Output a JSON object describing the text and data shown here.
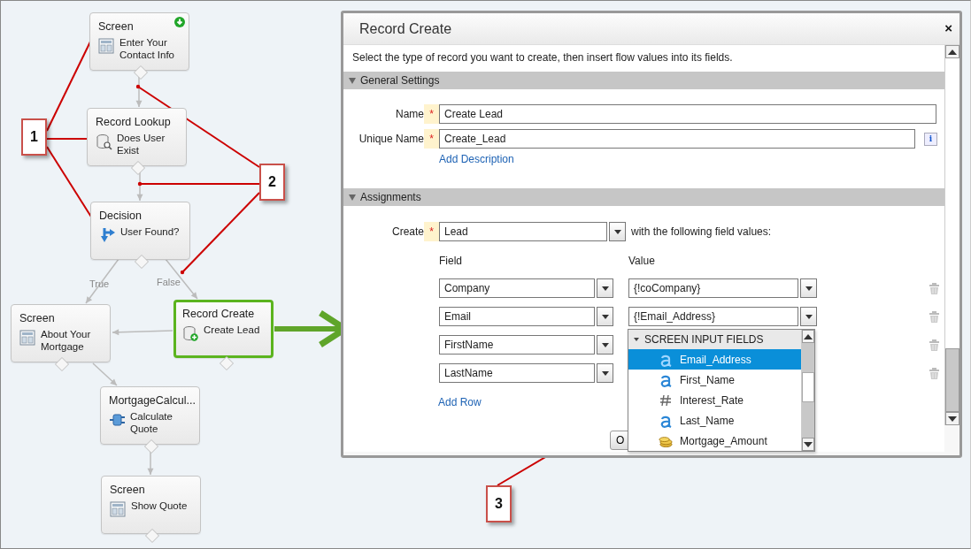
{
  "flow_nodes": [
    {
      "kind": "screen",
      "type": "Screen",
      "label": "Enter Your Contact Info",
      "start": true,
      "selected": false
    },
    {
      "kind": "lookup",
      "type": "Record Lookup",
      "label": "Does User Exist",
      "start": false,
      "selected": false
    },
    {
      "kind": "decision",
      "type": "Decision",
      "label": "User Found?",
      "start": false,
      "selected": false
    },
    {
      "kind": "screen",
      "type": "Screen",
      "label": "About Your Mortgage",
      "start": false,
      "selected": false
    },
    {
      "kind": "create",
      "type": "Record Create",
      "label": "Create Lead",
      "start": false,
      "selected": true
    },
    {
      "kind": "apex",
      "type": "MortgageCalcul...",
      "label": "Calculate Quote",
      "start": false,
      "selected": false
    },
    {
      "kind": "screen",
      "type": "Screen",
      "label": "Show Quote",
      "start": false,
      "selected": false
    }
  ],
  "branch_labels": [
    "True",
    "False"
  ],
  "callouts": [
    "1",
    "2",
    "3"
  ],
  "dialog": {
    "title": "Record Create",
    "close": "×",
    "intro": "Select the type of record you want to create, then insert flow values into its fields.",
    "general_settings": {
      "heading": "General Settings",
      "name_label": "Name",
      "name_mark": "*",
      "name_value": "Create Lead",
      "unique_label": "Unique Name",
      "unique_mark": "*",
      "unique_value": "Create_Lead",
      "info": "i",
      "add_description": "Add Description"
    },
    "assignments": {
      "heading": "Assignments",
      "create_label": "Create",
      "create_mark": "*",
      "create_value": "Lead",
      "create_suffix": "with the following field values:",
      "field_heading": "Field",
      "value_heading": "Value",
      "rows": [
        {
          "field": "Company",
          "value": "{!coCompany}"
        },
        {
          "field": "Email",
          "value": "{!Email_Address}"
        },
        {
          "field": "FirstName"
        },
        {
          "field": "LastName"
        }
      ],
      "add_row": "Add Row"
    },
    "ok_button": "O",
    "dropdown": {
      "group": "SCREEN INPUT FIELDS",
      "items": [
        {
          "kind": "text",
          "label": "Email_Address",
          "selected": true
        },
        {
          "kind": "text",
          "label": "First_Name",
          "selected": false
        },
        {
          "kind": "number",
          "label": "Interest_Rate",
          "selected": false
        },
        {
          "kind": "text",
          "label": "Last_Name",
          "selected": false
        },
        {
          "kind": "currency",
          "label": "Mortgage_Amount",
          "selected": false
        }
      ]
    }
  }
}
